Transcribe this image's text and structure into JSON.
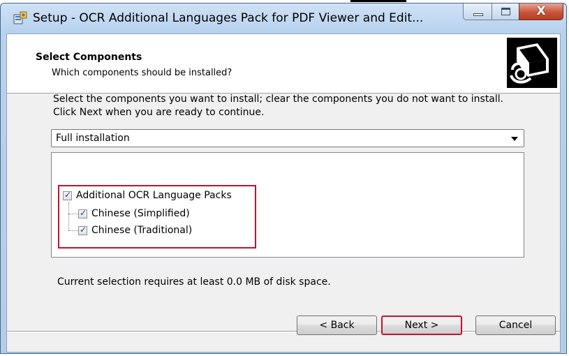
{
  "window": {
    "title": "Setup - OCR Additional Languages Pack for PDF Viewer and Edit...",
    "close_glyph": "X"
  },
  "header": {
    "title": "Select Components",
    "subtitle": "Which components should be installed?",
    "image_icon": "installer-computer-icon"
  },
  "description": "Select the components you want to install; clear the components you do not want to install. Click Next when you are ready to continue.",
  "install_type": {
    "selected": "Full installation"
  },
  "components": [
    {
      "label": "Additional OCR Language Packs",
      "checked": true,
      "level": 0
    },
    {
      "label": "Chinese (Simplified)",
      "checked": true,
      "level": 1
    },
    {
      "label": "Chinese (Traditional)",
      "checked": true,
      "level": 1
    }
  ],
  "space_note": "Current selection requires at least 0.0 MB of disk space.",
  "buttons": {
    "back": "< Back",
    "next": "Next >",
    "cancel": "Cancel"
  },
  "colors": {
    "highlight": "#c8102e",
    "checkmark": "#1b3f8a"
  }
}
